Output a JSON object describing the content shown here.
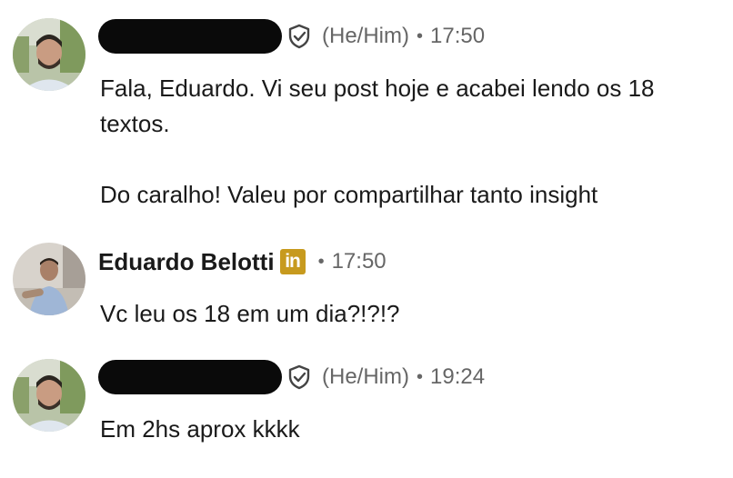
{
  "messages": [
    {
      "sender_redacted": true,
      "verified_icon": "shield-check-icon",
      "pronouns": "(He/Him)",
      "separator": "•",
      "time": "17:50",
      "lines": [
        "Fala, Eduardo. Vi seu post hoje e acabei lendo os 18",
        "textos.",
        "",
        "Do caralho! Valeu por compartilhar tanto insight"
      ]
    },
    {
      "name": "Eduardo Belotti",
      "badge_icon": "linkedin-icon",
      "badge_text": "in",
      "separator": "•",
      "time": "17:50",
      "lines": [
        "Vc leu os 18 em um dia?!?!?"
      ]
    },
    {
      "sender_redacted": true,
      "verified_icon": "shield-check-icon",
      "pronouns": "(He/Him)",
      "separator": "•",
      "time": "19:24",
      "lines": [
        "Em 2hs aprox kkkk"
      ]
    }
  ],
  "colors": {
    "text": "#1a1a1a",
    "muted": "#666666",
    "linkedin_badge": "#c79a1e",
    "redaction": "#0a0a0a"
  }
}
